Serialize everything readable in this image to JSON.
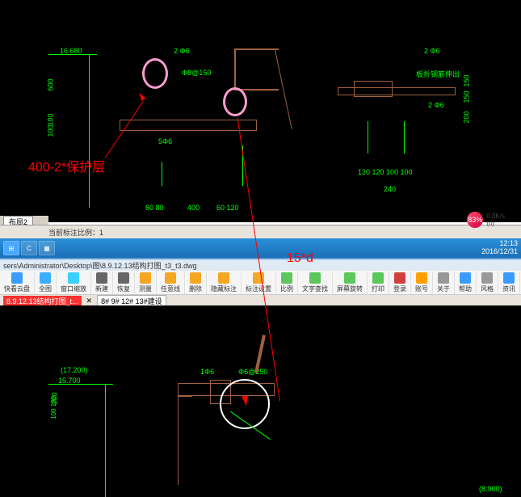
{
  "top_cad": {
    "labels": {
      "elev_16680": "16.680",
      "spec_206_l": "2 Φ6",
      "spec_206_r1": "2 Φ6",
      "spec_206_r2": "2 Φ6",
      "spacing": "Φ8@150",
      "note": "板折钢筋伸出",
      "dim_600": "600",
      "dim_100": "100",
      "dim_1001": "100",
      "dim_150a": "150",
      "dim_150b": "150",
      "dim_200": "200",
      "dim_5f6": "5Φ6",
      "dim_6080": "60 80",
      "dim_400": "400",
      "dim_60120": "60 120",
      "dim_240": "240",
      "dim_cluster": "120  120 100 100"
    },
    "tab_label": "布局2",
    "status_scale": "当前标注比例：1",
    "badge_pct": "83%",
    "badge_speed": "0.0K/s",
    "badge_count": "(0)"
  },
  "annotation1": "400-2*保护层",
  "annotation2": "15*d",
  "taskbar": {
    "time": "12:13",
    "date": "2016/12/31"
  },
  "titlebar_path": "sers\\Administrator\\Desktop\\图\\8.9.12.13结构打图_t3_t3.dwg",
  "toolbar": [
    {
      "label": "快看云盘",
      "color": "#3b9cff"
    },
    {
      "label": "全图",
      "color": "#3bafff"
    },
    {
      "label": "窗口缩放",
      "color": "#3bd0ff"
    },
    {
      "label": "新建",
      "color": "#666"
    },
    {
      "label": "恢复",
      "color": "#666"
    },
    {
      "label": "测量",
      "color": "#f5a623"
    },
    {
      "label": "任意线",
      "color": "#f5a623"
    },
    {
      "label": "删除",
      "color": "#f5a623"
    },
    {
      "label": "隐藏标注",
      "color": "#f5a623"
    },
    {
      "label": "标注设置",
      "color": "#f5a623"
    },
    {
      "label": "比例",
      "color": "#5ac85a"
    },
    {
      "label": "文字查找",
      "color": "#5ac85a"
    },
    {
      "label": "屏幕旋转",
      "color": "#5ac85a"
    },
    {
      "label": "打印",
      "color": "#5ac85a"
    },
    {
      "label": "登录",
      "color": "#d04040"
    },
    {
      "label": "账号",
      "color": "#ffa000"
    },
    {
      "label": "关于",
      "color": "#999"
    },
    {
      "label": "帮助",
      "color": "#3b9cff"
    },
    {
      "label": "风格",
      "color": "#999"
    },
    {
      "label": "资讯",
      "color": "#3b9cff"
    }
  ],
  "second_tabbar": {
    "active": "8.9.12.13结构打图_t...",
    "layers": "8# 9# 12# 13#建设"
  },
  "bottom_cad": {
    "elev_17200": "(17.200)",
    "elev_15700": "15.700",
    "dim_200": "200",
    "dim_100100": "100 100",
    "spec_1f6": "1Φ6",
    "spec_f6250": "Φ6@250",
    "dim_8900": "(8.900)"
  }
}
